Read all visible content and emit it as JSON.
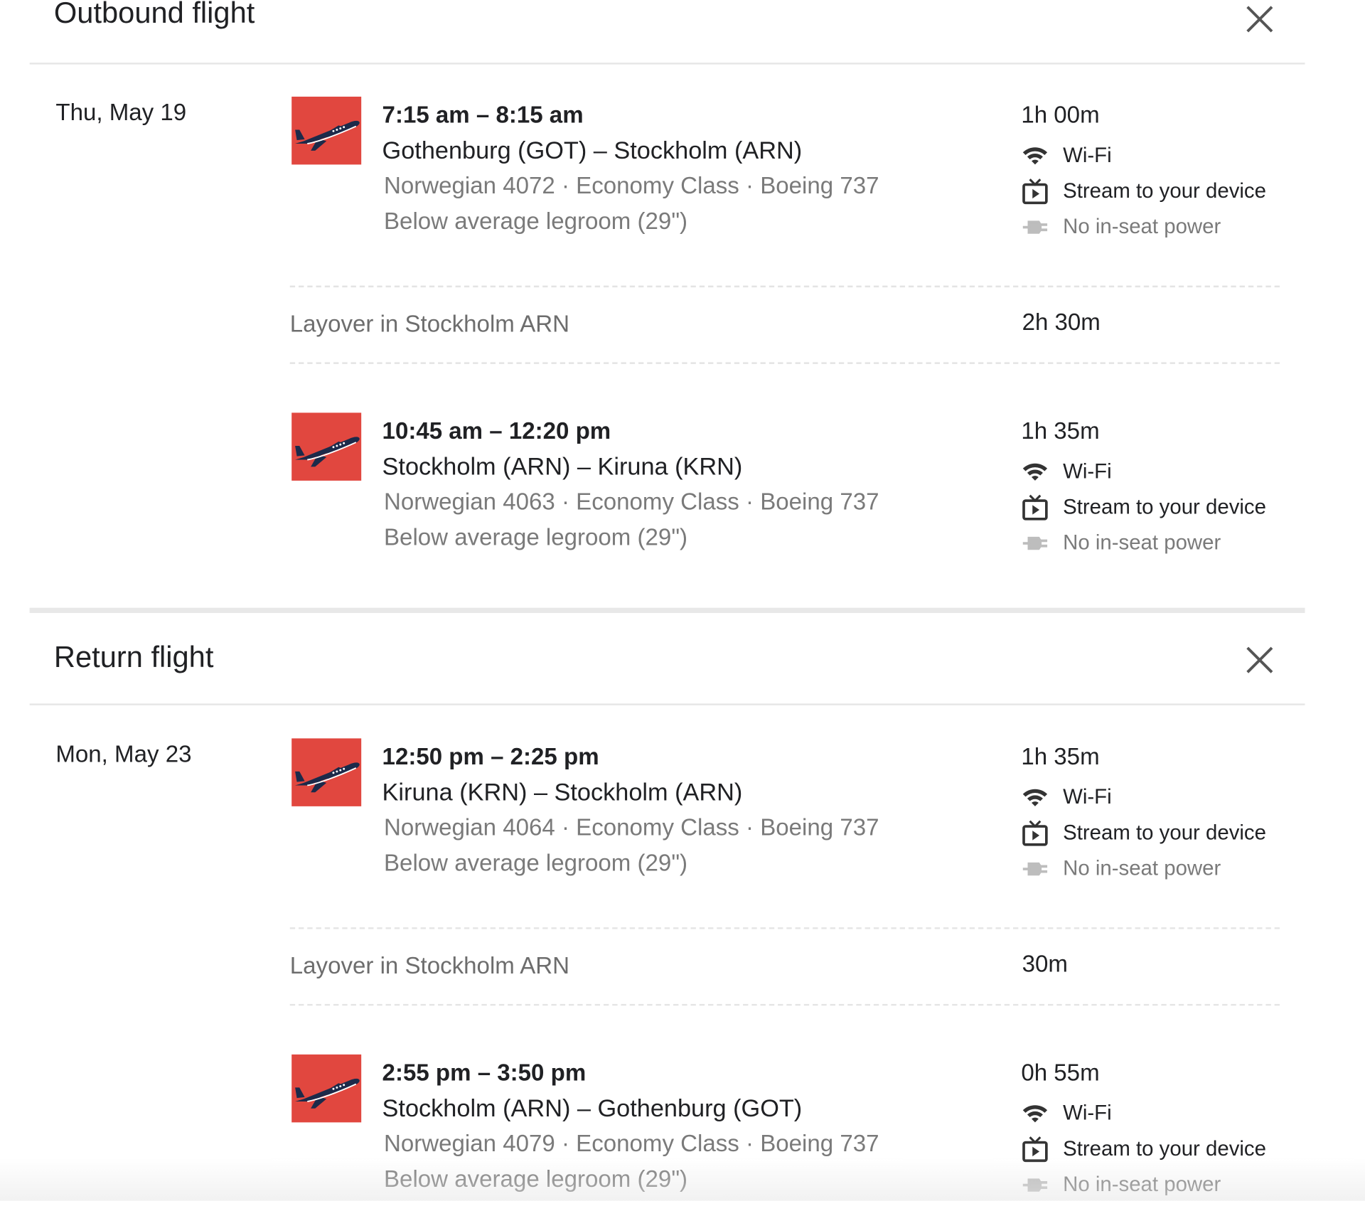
{
  "outbound": {
    "title": "Outbound flight",
    "date": "Thu, May 19",
    "legs": [
      {
        "time": "7:15 am – 8:15 am",
        "route": "Gothenburg (GOT) – Stockholm (ARN)",
        "details": "Norwegian 4072 · Economy Class · Boeing 737",
        "legroom": "Below average legroom (29\")",
        "duration": "1h 00m",
        "amenities": [
          "Wi-Fi",
          "Stream to your device",
          "No in-seat power"
        ]
      },
      {
        "time": "10:45 am – 12:20 pm",
        "route": "Stockholm (ARN) – Kiruna (KRN)",
        "details": "Norwegian 4063 · Economy Class · Boeing 737",
        "legroom": "Below average legroom (29\")",
        "duration": "1h 35m",
        "amenities": [
          "Wi-Fi",
          "Stream to your device",
          "No in-seat power"
        ]
      }
    ],
    "layover": {
      "label": "Layover in Stockholm ARN",
      "duration": "2h 30m"
    }
  },
  "return": {
    "title": "Return flight",
    "date": "Mon, May 23",
    "legs": [
      {
        "time": "12:50 pm – 2:25 pm",
        "route": "Kiruna (KRN) – Stockholm (ARN)",
        "details": "Norwegian 4064 · Economy Class · Boeing 737",
        "legroom": "Below average legroom (29\")",
        "duration": "1h 35m",
        "amenities": [
          "Wi-Fi",
          "Stream to your device",
          "No in-seat power"
        ]
      },
      {
        "time": "2:55 pm – 3:50 pm",
        "route": "Stockholm (ARN) – Gothenburg (GOT)",
        "details": "Norwegian 4079 · Economy Class · Boeing 737",
        "legroom": "Below average legroom (29\")",
        "duration": "0h 55m",
        "amenities": [
          "Wi-Fi",
          "Stream to your device",
          "No in-seat power"
        ]
      }
    ],
    "layover": {
      "label": "Layover in Stockholm ARN",
      "duration": "30m"
    }
  },
  "icons": {
    "close": "close-icon",
    "airline_logo": "airplane-logo-icon",
    "wifi": "wifi-icon",
    "stream": "tv-stream-icon",
    "power": "power-plug-icon"
  },
  "colors": {
    "airline_red": "#e1473f",
    "airline_navy": "#1c2a4a",
    "text_primary": "#202124",
    "text_secondary": "#7a7a7a"
  }
}
